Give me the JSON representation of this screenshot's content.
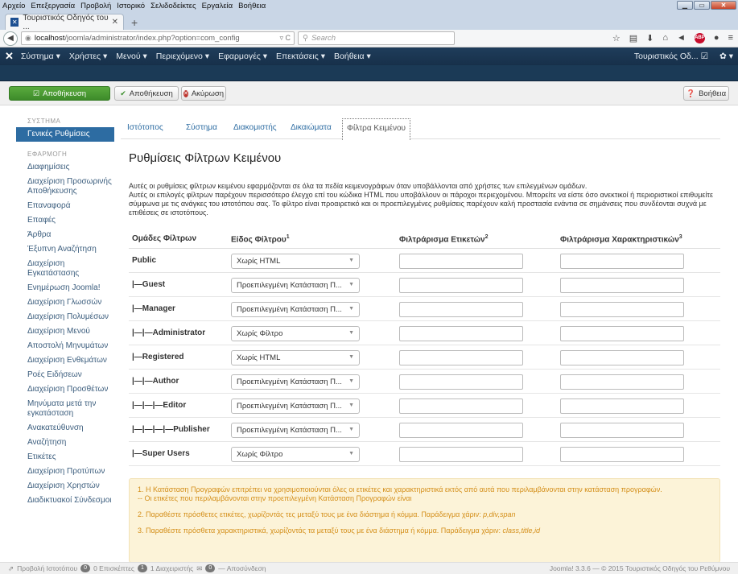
{
  "browser": {
    "menu": [
      "Αρχείο",
      "Επεξεργασία",
      "Προβολή",
      "Ιστορικό",
      "Σελιδοδείκτες",
      "Εργαλεία",
      "Βοήθεια"
    ],
    "tab_title": "Τουριστικός Οδηγός του ...",
    "url_host": "localhost",
    "url_path": "/joomla/administrator/index.php?option=com_config",
    "search_placeholder": "Search"
  },
  "joomla_nav": {
    "items": [
      "Σύστημα ▾",
      "Χρήστες ▾",
      "Μενού ▾",
      "Περιεχόμενο ▾",
      "Εφαρμογές ▾",
      "Επεκτάσεις ▾",
      "Βοήθεια ▾"
    ],
    "site_name": "Τουριστικός Οδ... ☑",
    "settings": "✿ ▾"
  },
  "toolbar": {
    "save": "Αποθήκευση",
    "save_close": "Αποθήκευση",
    "cancel": "Ακύρωση",
    "help": "Βοήθεια"
  },
  "sidebar": {
    "system_heading": "ΣΥΣΤΗΜΑ",
    "active": "Γενικές Ρυθμίσεις",
    "apps_heading": "ΕΦΑΡΜΟΓΗ",
    "items": [
      "Διαφημίσεις",
      "Διαχείριση Προσωρινής Αποθήκευσης",
      "Επαναφορά",
      "Επαφές",
      "Άρθρα",
      "Έξυπνη Αναζήτηση",
      "Διαχείριση Εγκατάστασης",
      "Ενημέρωση Joomla!",
      "Διαχείριση Γλωσσών",
      "Διαχείριση Πολυμέσων",
      "Διαχείριση Μενού",
      "Αποστολή Μηνυμάτων",
      "Διαχείριση Ενθεμάτων",
      "Ροές Ειδήσεων",
      "Διαχείριση Προσθέτων",
      "Μηνύματα μετά την εγκατάσταση",
      "Ανακατεύθυνση",
      "Αναζήτηση",
      "Ετικέτες",
      "Διαχείριση Προτύπων",
      "Διαχείριση Χρηστών",
      "Διαδικτυακοί Σύνδεσμοι"
    ]
  },
  "tabs": [
    "Ιστότοπος",
    "Σύστημα",
    "Διακομιστής",
    "Δικαιώματα",
    "Φίλτρα Κειμένου"
  ],
  "page_title": "Ρυθμίσεις Φίλτρων Κειμένου",
  "description": [
    "Αυτές οι ρυθμίσεις φίλτρων κειμένου εφαρμόζονται σε όλα τα πεδία κειμενογράφων όταν υποβάλλονται από χρήστες των επιλεγμένων ομάδων.",
    "Αυτές οι επιλογές φίλτρων παρέχουν περισσότερο έλεγχο επί του κώδικα HTML που υποβάλλουν οι πάροχοι περιεχομένου. Μπορείτε να είστε όσο ανεκτικοί ή περιοριστικοί επιθυμείτε σύμφωνα με τις ανάγκες του ιστοτόπου σας. Το φίλτρο είναι προαιρετικό και οι προεπιλεγμένες ρυθμίσεις παρέχουν καλή προστασία ενάντια σε σημάνσεις που συνδέονται συχνά με επιθέσεις σε ιστοτόπους."
  ],
  "table": {
    "headers": {
      "groups": "Ομάδες Φίλτρων",
      "type": "Είδος Φίλτρου",
      "type_sup": "1",
      "tags": "Φιλτράρισμα Ετικετών",
      "tags_sup": "2",
      "attrs": "Φιλτράρισμα Χαρακτηριστικών",
      "attrs_sup": "3"
    },
    "rows": [
      {
        "group": "Public",
        "type": "Χωρίς HTML"
      },
      {
        "group": "|—Guest",
        "type": "Προεπιλεγμένη Κατάσταση Π..."
      },
      {
        "group": "|—Manager",
        "type": "Προεπιλεγμένη Κατάσταση Π..."
      },
      {
        "group": "|—|—Administrator",
        "type": "Χωρίς Φίλτρο"
      },
      {
        "group": "|—Registered",
        "type": "Χωρίς HTML"
      },
      {
        "group": "|—|—Author",
        "type": "Προεπιλεγμένη Κατάσταση Π..."
      },
      {
        "group": "|—|—|—Editor",
        "type": "Προεπιλεγμένη Κατάσταση Π..."
      },
      {
        "group": "|—|—|—|—Publisher",
        "type": "Προεπιλεγμένη Κατάσταση Π..."
      },
      {
        "group": "|—Super Users",
        "type": "Χωρίς Φίλτρο"
      }
    ]
  },
  "notes": {
    "n1a": "1. Η Κατάσταση Προγραφών επιτρέπει να χρησιμοποιούνται όλες οι ετικέτες και χαρακτηριστικά εκτός από αυτά που περιλαμβάνονται στην κατάσταση προγραφών.",
    "n1b": "-- Οι ετικέτες που περιλαμβάνονται στην προεπιλεγμένη Κατάσταση Προγραφών είναι",
    "n2": "2. Παραθέστε πρόσθετες ετικέτες, χωρίζοντάς τες μεταξύ τους με ένα διάστημα ή κόμμα. Παράδειγμα χάριν: ",
    "n2_ex": "p,div,span",
    "n3": "3. Παραθέστε πρόσθετα χαρακτηριστικά, χωρίζοντάς τα μεταξύ τους με ένα διάστημα ή κόμμα. Παράδειγμα χάριν: ",
    "n3_ex": "class,title,id"
  },
  "status": {
    "view_site": "Προβολή Ιστοτόπου",
    "visitors_count": "0",
    "visitors": "0 Επισκέπτες",
    "admins_count": "1",
    "admins": "1 Διαχειριστής",
    "messages_count": "0",
    "logout": "— Αποσύνδεση",
    "version": "Joomla! 3.3.6 — © 2015 Τουριστικός Οδηγός του Ρεθύμνου"
  }
}
